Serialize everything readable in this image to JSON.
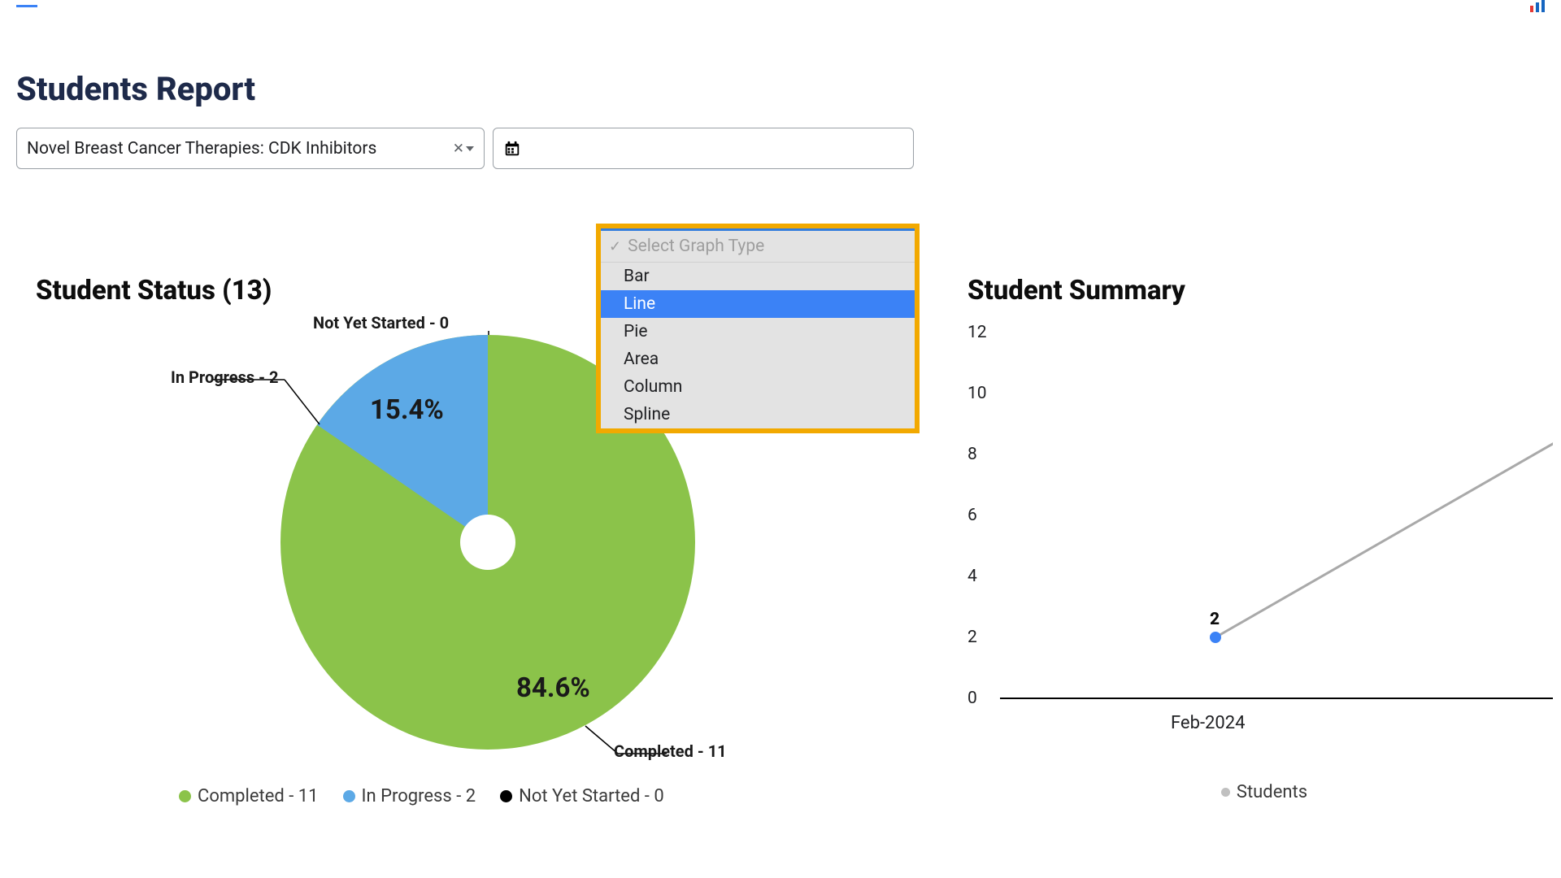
{
  "header": {
    "title": "Students Report"
  },
  "filters": {
    "course_text": "Novel Breast Cancer Therapies: CDK Inhibitors",
    "clear_glyph": "✕"
  },
  "dropdown": {
    "placeholder": "Select Graph Type",
    "options": [
      "Bar",
      "Line",
      "Pie",
      "Area",
      "Column",
      "Spline"
    ],
    "selected": "Line"
  },
  "status_panel": {
    "title": "Student Status (13)",
    "labels": {
      "completed": "Completed - 11",
      "in_progress": "In Progress - 2",
      "not_started": "Not Yet Started - 0",
      "pct_completed": "84.6%",
      "pct_in_progress": "15.4%"
    }
  },
  "summary_panel": {
    "title": "Student Summary",
    "series_name": "Students",
    "x_tick": "Feb-2024",
    "point_label": "2",
    "y_ticks": [
      "0",
      "2",
      "4",
      "6",
      "8",
      "10",
      "12"
    ]
  },
  "legend": {
    "completed": "Completed - 11",
    "in_progress": "In Progress - 2",
    "not_started": "Not Yet Started - 0"
  },
  "colors": {
    "completed": "#8bc34a",
    "in_progress": "#5ca9e6",
    "not_started": "#000000",
    "accent": "#3b82f6"
  },
  "chart_data": [
    {
      "type": "pie",
      "title": "Student Status (13)",
      "categories": [
        "Completed",
        "In Progress",
        "Not Yet Started"
      ],
      "values": [
        11,
        2,
        0
      ],
      "percentages": [
        84.6,
        15.4,
        0
      ],
      "colors": [
        "#8bc34a",
        "#5ca9e6",
        "#000000"
      ]
    },
    {
      "type": "line",
      "title": "Student Summary",
      "series": [
        {
          "name": "Students",
          "values": [
            2
          ]
        }
      ],
      "x": [
        "Feb-2024"
      ],
      "ylim": [
        0,
        12
      ],
      "ylabel": "",
      "xlabel": ""
    }
  ]
}
